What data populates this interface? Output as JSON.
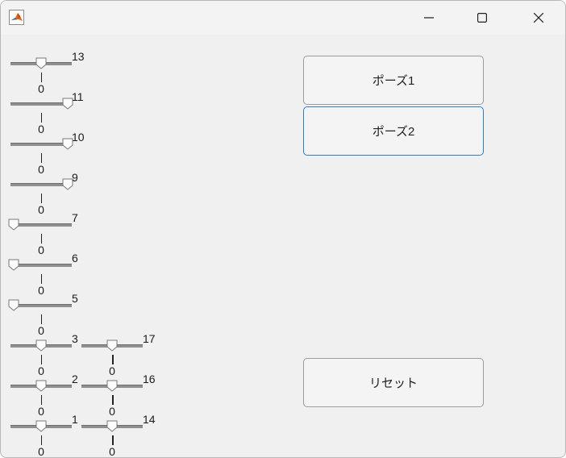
{
  "window": {
    "title": "",
    "controls": {
      "minimize": "minimize-icon",
      "maximize": "maximize-icon",
      "close": "close-icon"
    }
  },
  "buttons": {
    "pose1": "ポーズ1",
    "pose2": "ポーズ2",
    "reset": "リセット"
  },
  "sliders": [
    {
      "id": "13",
      "min_label": "0",
      "max_label": "13",
      "value_fraction": 0.5
    },
    {
      "id": "11",
      "min_label": "0",
      "max_label": "11",
      "value_fraction": 0.93
    },
    {
      "id": "10",
      "min_label": "0",
      "max_label": "10",
      "value_fraction": 0.93
    },
    {
      "id": "9",
      "min_label": "0",
      "max_label": "9",
      "value_fraction": 0.93
    },
    {
      "id": "7",
      "min_label": "0",
      "max_label": "7",
      "value_fraction": 0.05
    },
    {
      "id": "6",
      "min_label": "0",
      "max_label": "6",
      "value_fraction": 0.05
    },
    {
      "id": "5",
      "min_label": "0",
      "max_label": "5",
      "value_fraction": 0.05
    },
    {
      "id": "3",
      "min_label": "0",
      "max_label": "3",
      "value_fraction": 0.5
    },
    {
      "id": "2",
      "min_label": "0",
      "max_label": "2",
      "value_fraction": 0.5
    },
    {
      "id": "1",
      "min_label": "0",
      "max_label": "1",
      "value_fraction": 0.5
    },
    {
      "id": "17",
      "min_label": "0",
      "max_label": "17",
      "value_fraction": 0.5
    },
    {
      "id": "16",
      "min_label": "0",
      "max_label": "16",
      "value_fraction": 0.5
    },
    {
      "id": "14",
      "min_label": "0",
      "max_label": "14",
      "value_fraction": 0.5
    }
  ]
}
